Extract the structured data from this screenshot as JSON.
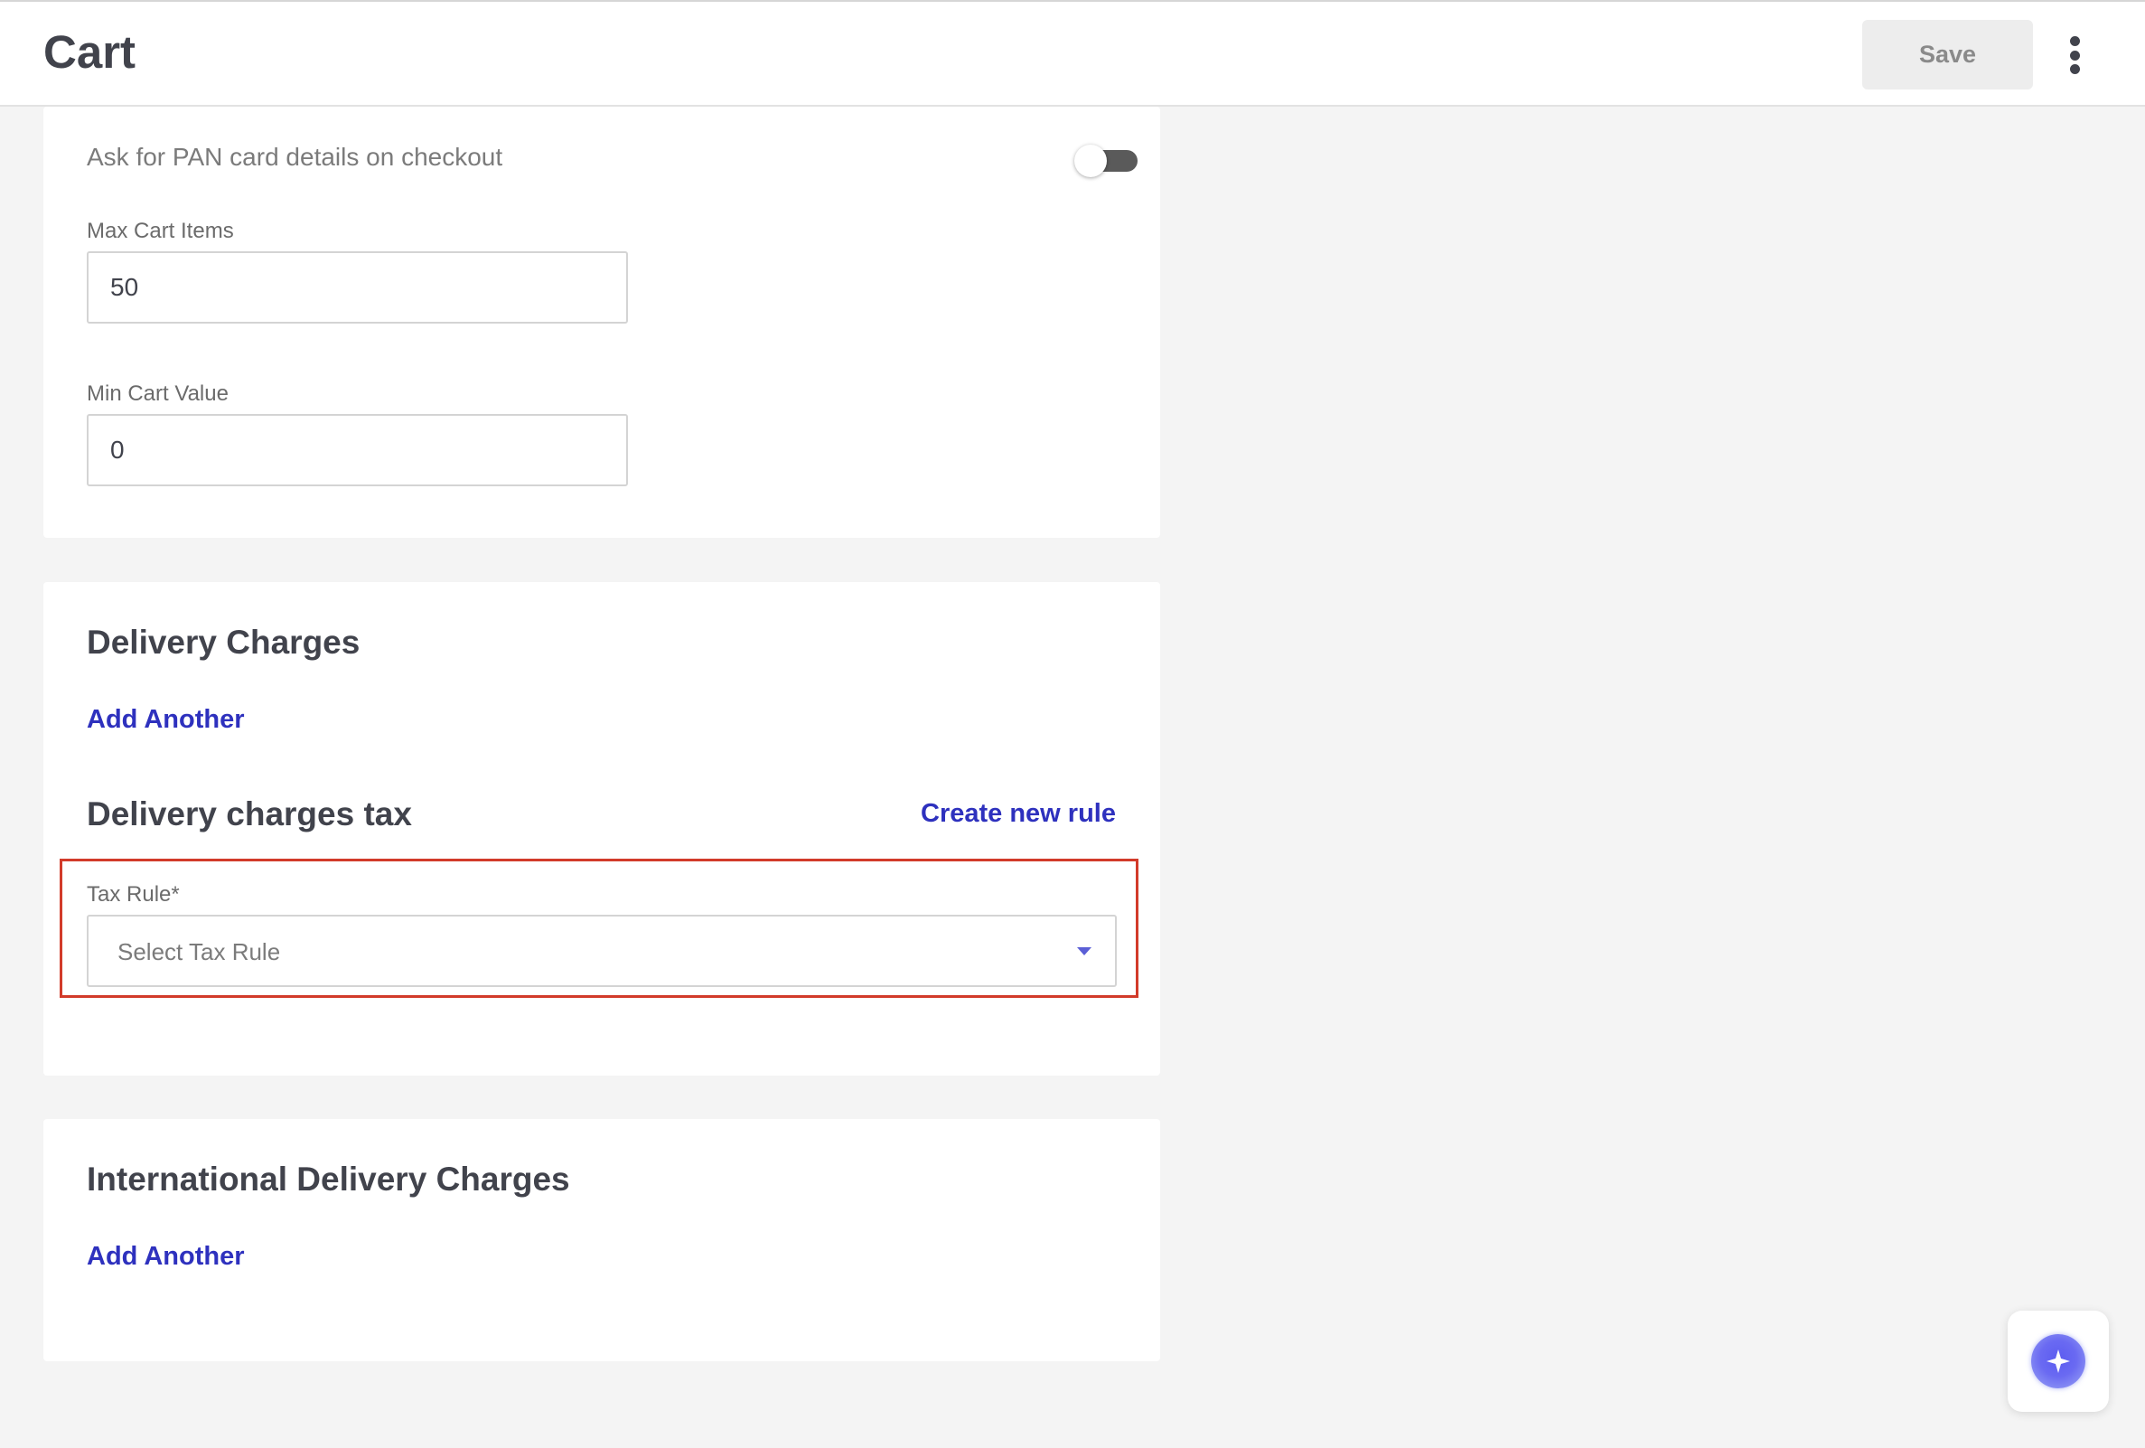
{
  "header": {
    "title": "Cart",
    "save_label": "Save",
    "more_icon": "kebab-vertical-icon"
  },
  "cart_settings": {
    "pan_toggle_label": "Ask for PAN card details on checkout",
    "pan_toggle_on": false,
    "max_items_label": "Max Cart Items",
    "max_items_value": "50",
    "min_value_label": "Min Cart Value",
    "min_value_value": "0"
  },
  "delivery_charges": {
    "title": "Delivery Charges",
    "add_another_label": "Add Another",
    "tax_title": "Delivery charges tax",
    "create_rule_label": "Create new rule",
    "tax_rule_label": "Tax Rule*",
    "tax_rule_placeholder": "Select Tax Rule"
  },
  "international_delivery": {
    "title": "International Delivery Charges",
    "add_another_label": "Add Another"
  },
  "assistant": {
    "icon": "sparkle-icon",
    "accent": "#5c5cf0"
  },
  "colors": {
    "link": "#2e31be",
    "highlight": "#d23b2a"
  }
}
